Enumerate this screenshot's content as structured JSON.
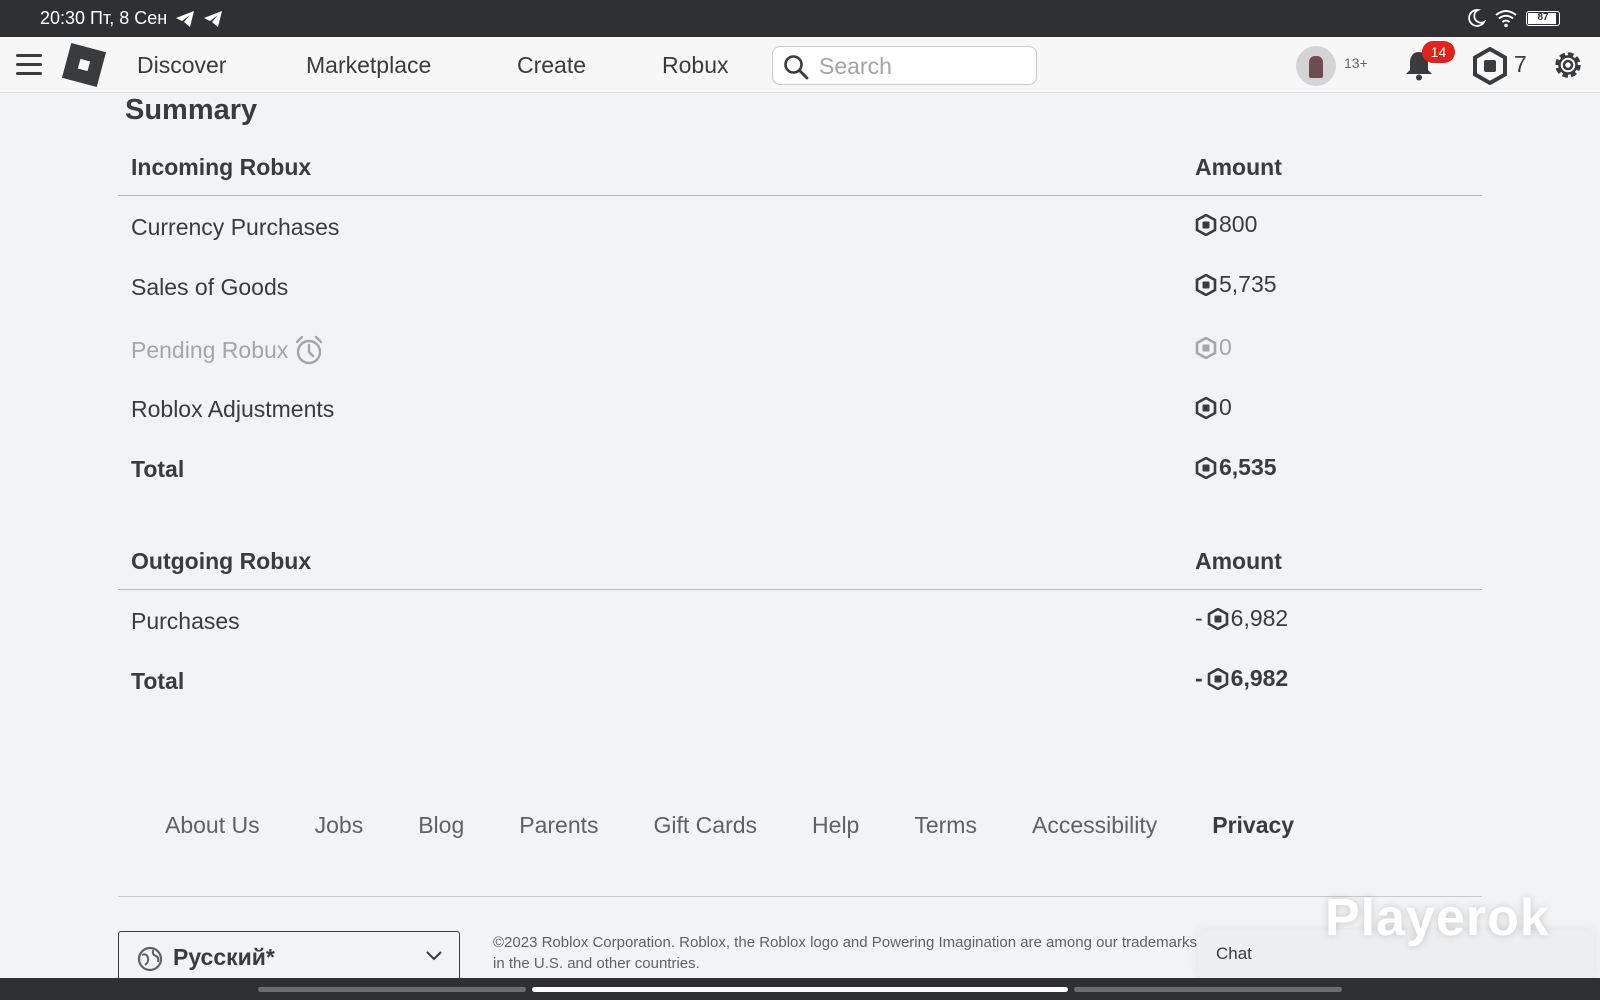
{
  "status_bar": {
    "time_date": "20:30 Пт, 8 Сен",
    "battery": "87"
  },
  "nav": {
    "links": [
      "Discover",
      "Marketplace",
      "Create",
      "Robux"
    ],
    "search_placeholder": "Search",
    "age_label": "13+",
    "notification_count": "14",
    "robux_balance": "7"
  },
  "summary": {
    "title": "Summary",
    "incoming": {
      "header": "Incoming Robux",
      "amount_header": "Amount",
      "rows": [
        {
          "label": "Currency Purchases",
          "amount": "800"
        },
        {
          "label": "Sales of Goods",
          "amount": "5,735"
        },
        {
          "label": "Pending Robux",
          "amount": "0"
        },
        {
          "label": "Roblox Adjustments",
          "amount": "0"
        }
      ],
      "total_label": "Total",
      "total_amount": "6,535"
    },
    "outgoing": {
      "header": "Outgoing Robux",
      "amount_header": "Amount",
      "rows": [
        {
          "label": "Purchases",
          "sign": "-",
          "amount": "6,982"
        }
      ],
      "total_label": "Total",
      "total_sign": "-",
      "total_amount": "6,982"
    }
  },
  "footer": {
    "links": [
      "About Us",
      "Jobs",
      "Blog",
      "Parents",
      "Gift Cards",
      "Help",
      "Terms",
      "Accessibility",
      "Privacy"
    ],
    "language": "Русский*",
    "copyright": "©2023 Roblox Corporation. Roblox, the Roblox logo and Powering Imagination are among our trademarks in the U.S. and other countries."
  },
  "chat": {
    "label": "Chat"
  },
  "watermark": "Playerok",
  "colors": {
    "accent_red": "#e2231a",
    "text": "#393b3d",
    "background": "#f2f3f5"
  }
}
